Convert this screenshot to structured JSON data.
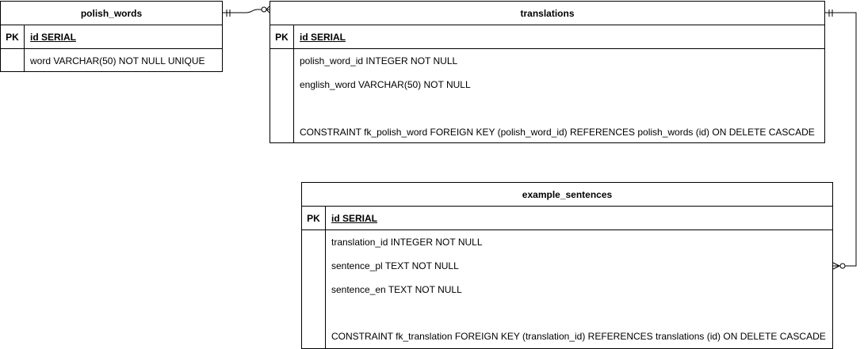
{
  "tables": {
    "polish_words": {
      "name": "polish_words",
      "pk_label": "PK",
      "pk_field": "id SERIAL",
      "fields": [
        "word VARCHAR(50) NOT NULL UNIQUE"
      ]
    },
    "translations": {
      "name": "translations",
      "pk_label": "PK",
      "pk_field": "id SERIAL",
      "fields": [
        "polish_word_id INTEGER NOT NULL",
        "english_word VARCHAR(50) NOT NULL",
        "",
        "CONSTRAINT fk_polish_word FOREIGN KEY (polish_word_id) REFERENCES polish_words (id) ON DELETE CASCADE"
      ]
    },
    "example_sentences": {
      "name": "example_sentences",
      "pk_label": "PK",
      "pk_field": "id SERIAL",
      "fields": [
        "translation_id INTEGER NOT NULL",
        "sentence_pl TEXT NOT NULL",
        "sentence_en TEXT NOT NULL",
        "",
        "CONSTRAINT fk_translation FOREIGN KEY (translation_id) REFERENCES translations (id) ON DELETE CASCADE"
      ]
    }
  },
  "relationships": [
    {
      "from": "polish_words",
      "from_cardinality": "one",
      "to": "translations",
      "to_cardinality": "zero-or-many"
    },
    {
      "from": "translations",
      "from_cardinality": "one",
      "to": "example_sentences",
      "to_cardinality": "zero-or-many"
    }
  ]
}
